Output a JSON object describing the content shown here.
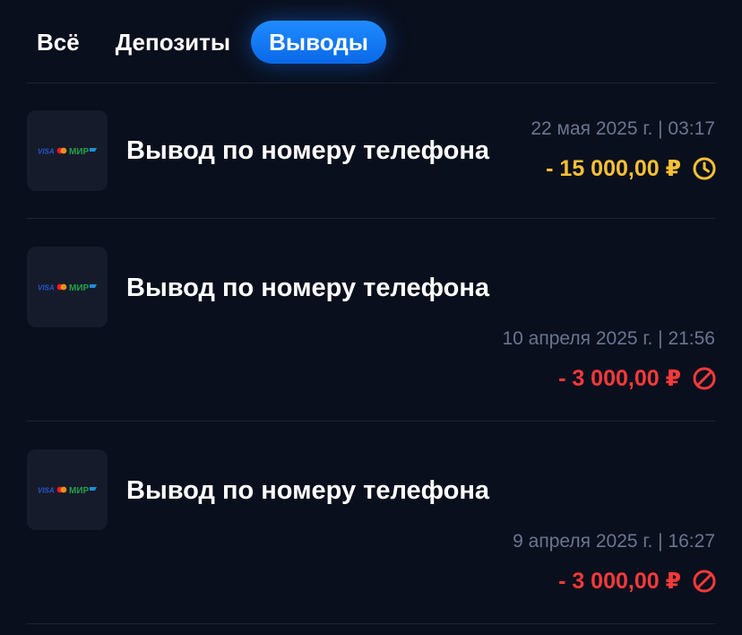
{
  "tabs": [
    {
      "label": "Всё",
      "active": false
    },
    {
      "label": "Депозиты",
      "active": false
    },
    {
      "label": "Выводы",
      "active": true
    }
  ],
  "colors": {
    "background": "#0a0f1d",
    "tab_active": "#1279f5",
    "pending": "#f7c136",
    "declined": "#f53a3a",
    "muted_text": "#6a7590"
  },
  "transactions": [
    {
      "payment_logo": {
        "visa": "VISA",
        "mir": "МИР"
      },
      "title": "Вывод по номеру телефона",
      "datetime": "22 мая 2025 г. | 03:17",
      "amount": "- 15 000,00 ₽",
      "status": "pending",
      "status_icon": "clock-icon"
    },
    {
      "payment_logo": {
        "visa": "VISA",
        "mir": "МИР"
      },
      "title": "Вывод по номеру телефона",
      "datetime": "10 апреля 2025 г. | 21:56",
      "amount": "- 3 000,00 ₽",
      "status": "declined",
      "status_icon": "declined-icon"
    },
    {
      "payment_logo": {
        "visa": "VISA",
        "mir": "МИР"
      },
      "title": "Вывод по номеру телефона",
      "datetime": "9 апреля 2025 г. | 16:27",
      "amount": "- 3 000,00 ₽",
      "status": "declined",
      "status_icon": "declined-icon"
    }
  ]
}
